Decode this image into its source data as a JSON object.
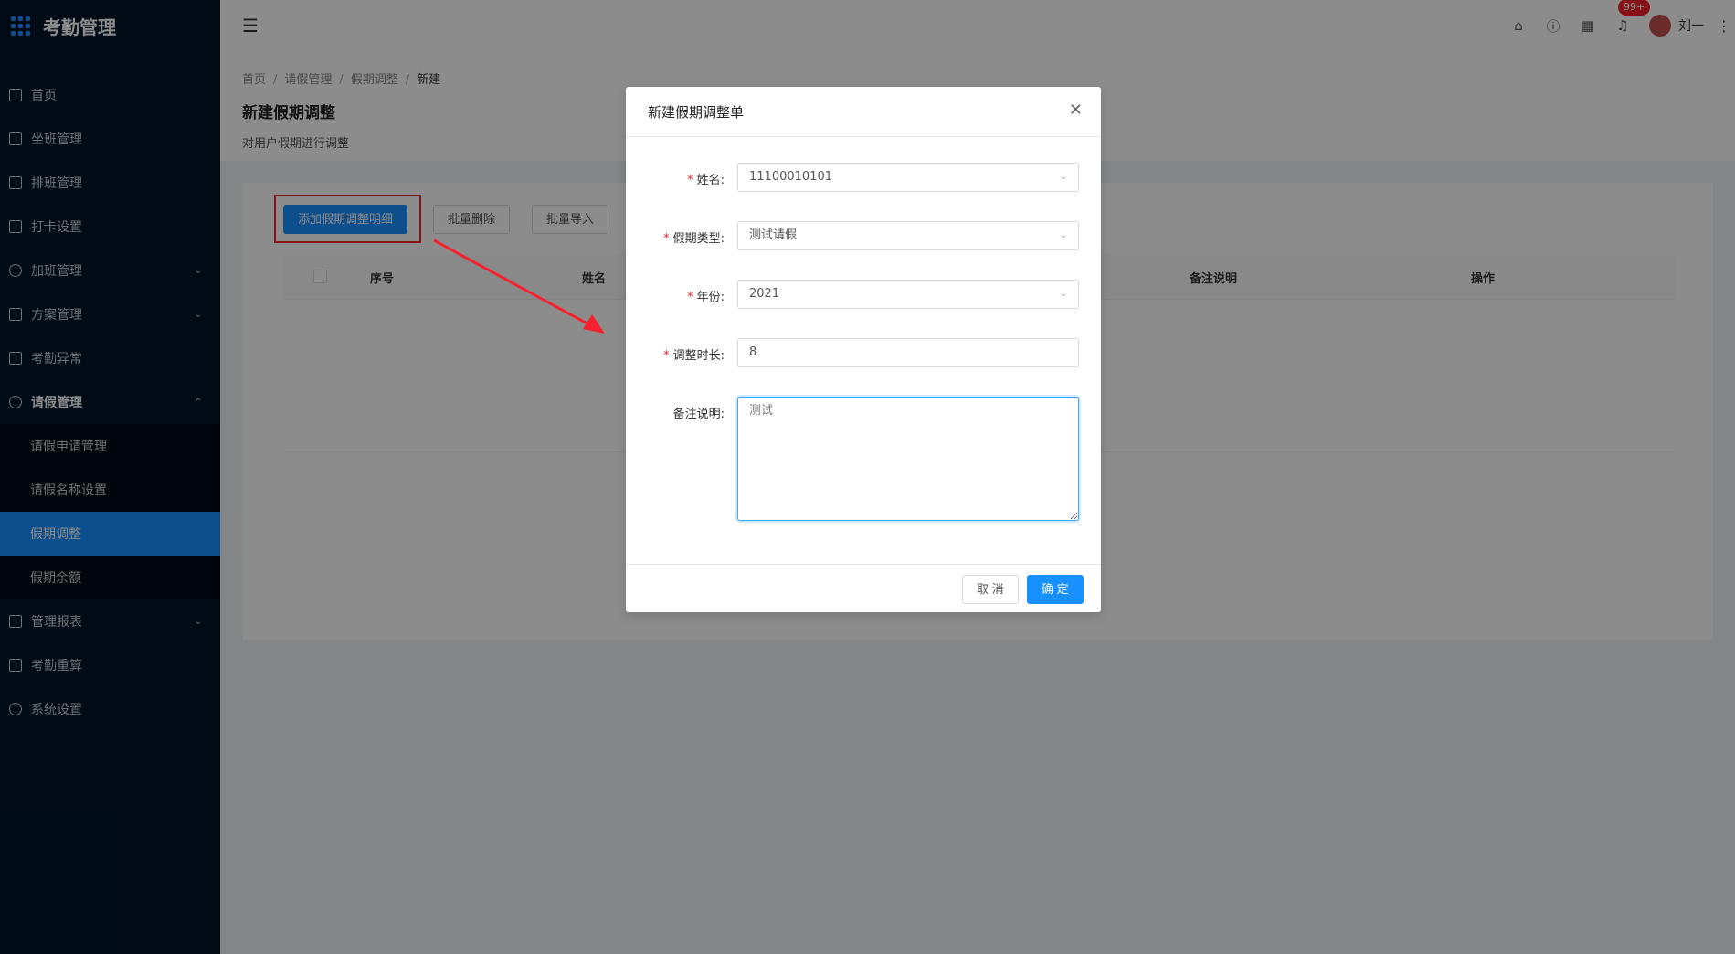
{
  "sidebar": {
    "app_title": "考勤管理",
    "items": [
      {
        "label": "首页",
        "icon": "home-icon"
      },
      {
        "label": "坐班管理",
        "icon": "calendar-check-icon"
      },
      {
        "label": "排班管理",
        "icon": "calendar-icon"
      },
      {
        "label": "打卡设置",
        "icon": "edit-icon"
      },
      {
        "label": "加班管理",
        "icon": "clock-icon"
      },
      {
        "label": "方案管理",
        "icon": "document-icon"
      },
      {
        "label": "考勤异常",
        "icon": "alarm-icon"
      },
      {
        "label": "请假管理",
        "icon": "leave-icon"
      },
      {
        "label": "管理报表",
        "icon": "report-icon"
      },
      {
        "label": "考勤重算",
        "icon": "calculator-icon"
      },
      {
        "label": "系统设置",
        "icon": "gear-icon"
      }
    ],
    "submenu": [
      {
        "label": "请假申请管理"
      },
      {
        "label": "请假名称设置"
      },
      {
        "label": "假期调整"
      },
      {
        "label": "假期余额"
      }
    ]
  },
  "header": {
    "badge": "99+",
    "username": "刘一"
  },
  "page": {
    "breadcrumb": [
      "首页",
      "请假管理",
      "假期调整",
      "新建"
    ],
    "title": "新建假期调整",
    "description": "对用户假期进行调整"
  },
  "toolbar": {
    "add_label": "添加假期调整明细",
    "batch_delete_label": "批量删除",
    "batch_import_label": "批量导入"
  },
  "table": {
    "columns": [
      "序号",
      "姓名",
      "备注说明",
      "操作"
    ]
  },
  "modal": {
    "title": "新建假期调整单",
    "fields": {
      "name": {
        "label": "姓名:",
        "value": "11100010101"
      },
      "leave_type": {
        "label": "假期类型:",
        "value": "测试请假"
      },
      "year": {
        "label": "年份:",
        "value": "2021"
      },
      "duration": {
        "label": "调整时长:",
        "value": "8"
      },
      "remark": {
        "label": "备注说明:",
        "placeholder": "测试"
      }
    },
    "cancel_label": "取 消",
    "ok_label": "确 定"
  },
  "colors": {
    "sidebar_bg": "#001529",
    "primary": "#1890ff",
    "annotation_red": "#f5222d"
  }
}
